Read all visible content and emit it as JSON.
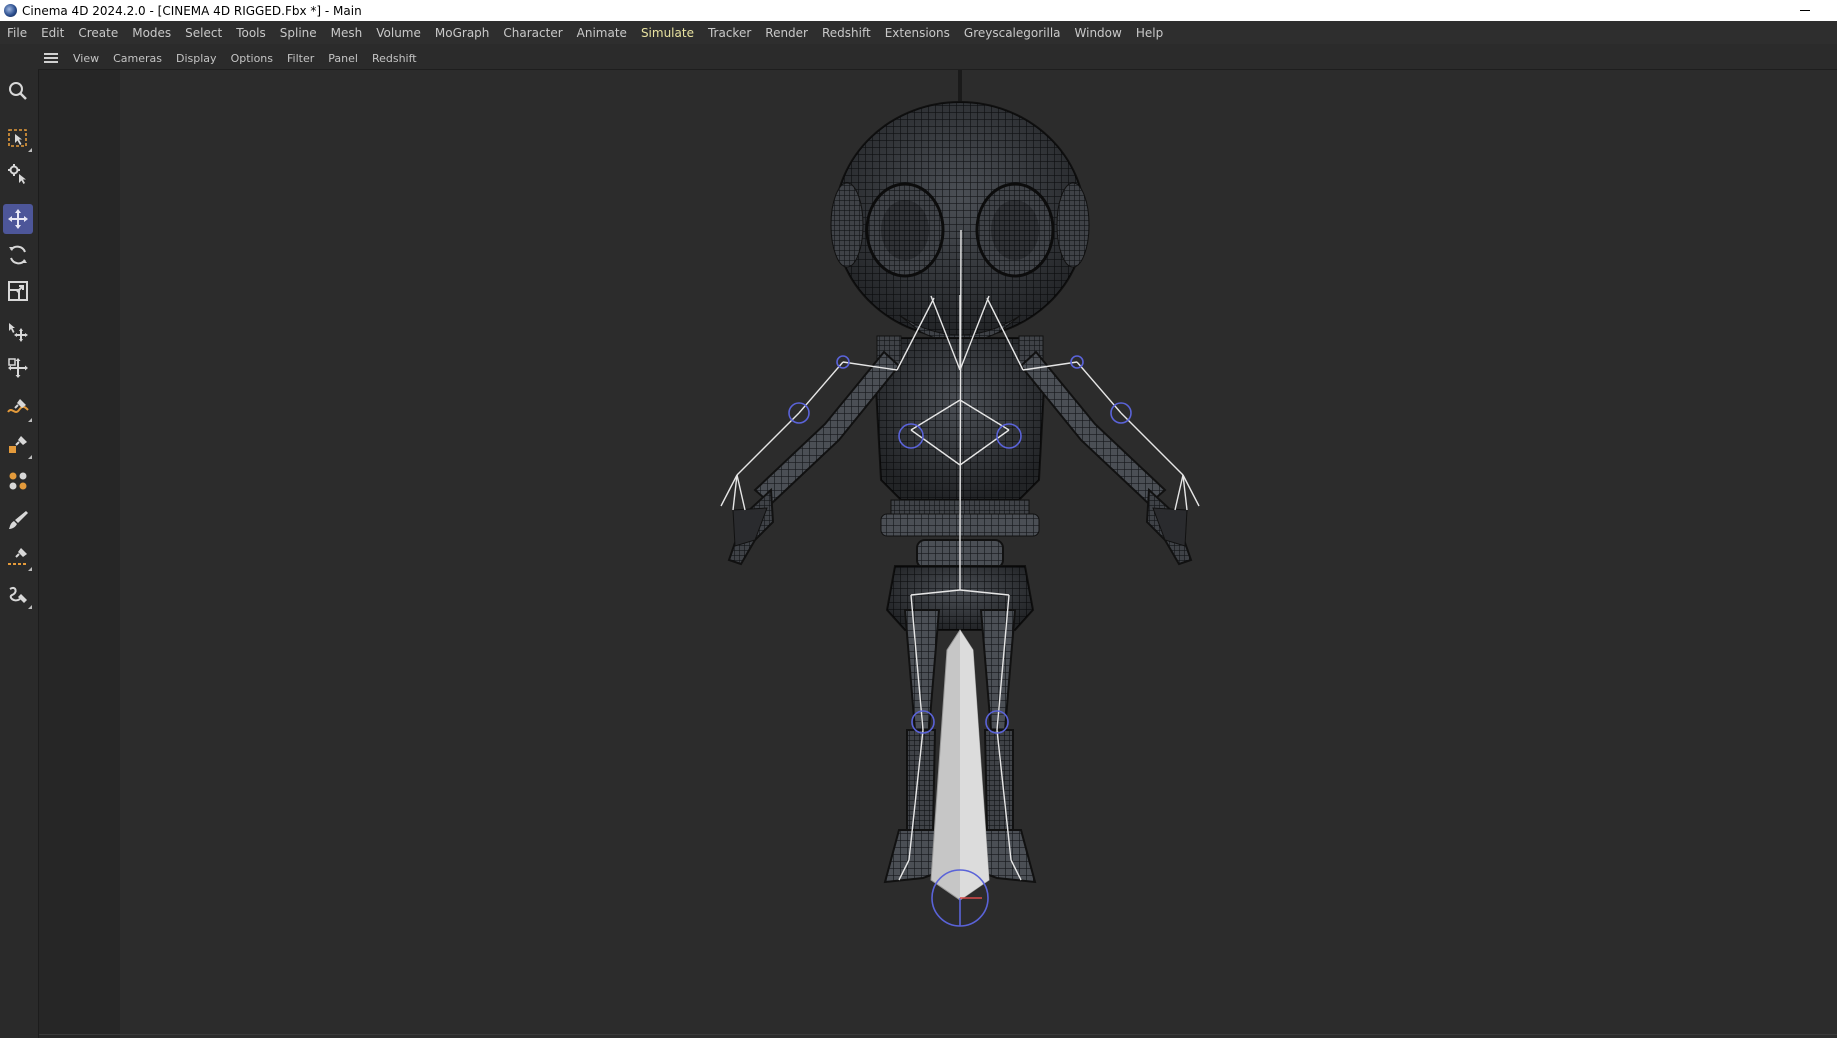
{
  "window": {
    "title": "Cinema 4D 2024.2.0 - [CINEMA 4D RIGGED.Fbx *] - Main",
    "app_icon": "cinema4d-logo-icon",
    "controls": [
      "minimize-icon"
    ]
  },
  "menubar": {
    "items": [
      {
        "label": "File"
      },
      {
        "label": "Edit"
      },
      {
        "label": "Create"
      },
      {
        "label": "Modes"
      },
      {
        "label": "Select"
      },
      {
        "label": "Tools"
      },
      {
        "label": "Spline"
      },
      {
        "label": "Mesh"
      },
      {
        "label": "Volume"
      },
      {
        "label": "MoGraph"
      },
      {
        "label": "Character"
      },
      {
        "label": "Animate"
      },
      {
        "label": "Simulate",
        "highlighted": true
      },
      {
        "label": "Tracker"
      },
      {
        "label": "Render"
      },
      {
        "label": "Redshift"
      },
      {
        "label": "Extensions"
      },
      {
        "label": "Greyscalegorilla"
      },
      {
        "label": "Window"
      },
      {
        "label": "Help"
      }
    ]
  },
  "viewport_menu": {
    "icon": "hamburger-menu-icon",
    "items": [
      {
        "label": "View"
      },
      {
        "label": "Cameras"
      },
      {
        "label": "Display"
      },
      {
        "label": "Options"
      },
      {
        "label": "Filter"
      },
      {
        "label": "Panel"
      },
      {
        "label": "Redshift"
      }
    ]
  },
  "toolbar": {
    "tools": [
      {
        "icon": "search-icon",
        "active": false
      },
      {
        "icon": "live-selection-icon",
        "active": false
      },
      {
        "icon": "tweak-mode-icon",
        "active": false
      },
      {
        "icon": "move-icon",
        "active": true
      },
      {
        "icon": "rotate-icon",
        "active": false
      },
      {
        "icon": "scale-icon",
        "active": false
      },
      {
        "icon": "axis-move-icon",
        "active": false
      },
      {
        "icon": "transform-icon",
        "active": false
      },
      {
        "icon": "spline-pen-icon",
        "active": false
      },
      {
        "icon": "create-object-pen-icon",
        "active": false
      },
      {
        "icon": "cloner-icon",
        "active": false
      },
      {
        "icon": "paint-brush-icon",
        "active": false
      },
      {
        "icon": "line-cut-icon",
        "active": false
      },
      {
        "icon": "polygon-pen-icon",
        "active": false
      }
    ]
  },
  "viewport": {
    "content": "rigged-character-wireframe",
    "colors": {
      "background": "#2c2c2c",
      "mesh_wire": "#1a1a1a",
      "bones": "#e8e8e8",
      "joint_circles": "#5a63d8",
      "accent_active": "#4d5699"
    }
  }
}
